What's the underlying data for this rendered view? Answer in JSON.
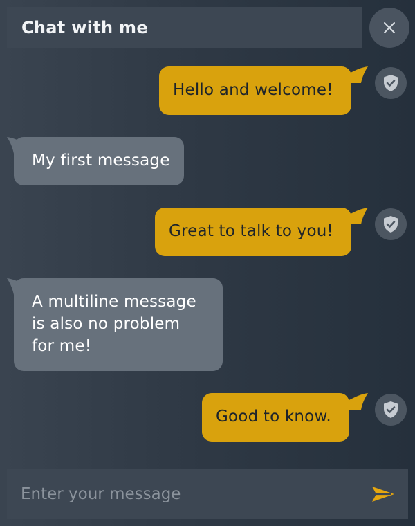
{
  "header": {
    "title": "Chat with me",
    "close_icon": "close-icon"
  },
  "messages": [
    {
      "from": "me",
      "text": "Hello and welcome!",
      "avatar_icon": "shield-check-icon"
    },
    {
      "from": "them",
      "text": "My first message"
    },
    {
      "from": "me",
      "text": "Great to talk to you!",
      "avatar_icon": "shield-check-icon"
    },
    {
      "from": "them",
      "lines": [
        "A multiline message",
        "is also no problem",
        "for me!"
      ]
    },
    {
      "from": "me",
      "text": "Good to know.",
      "avatar_icon": "shield-check-icon"
    }
  ],
  "composer": {
    "placeholder": "Enter your message",
    "value": "",
    "send_icon": "send-icon"
  },
  "colors": {
    "outgoing_bubble": "#d9a20d",
    "incoming_bubble": "#67717c",
    "accent": "#e6a70f"
  }
}
